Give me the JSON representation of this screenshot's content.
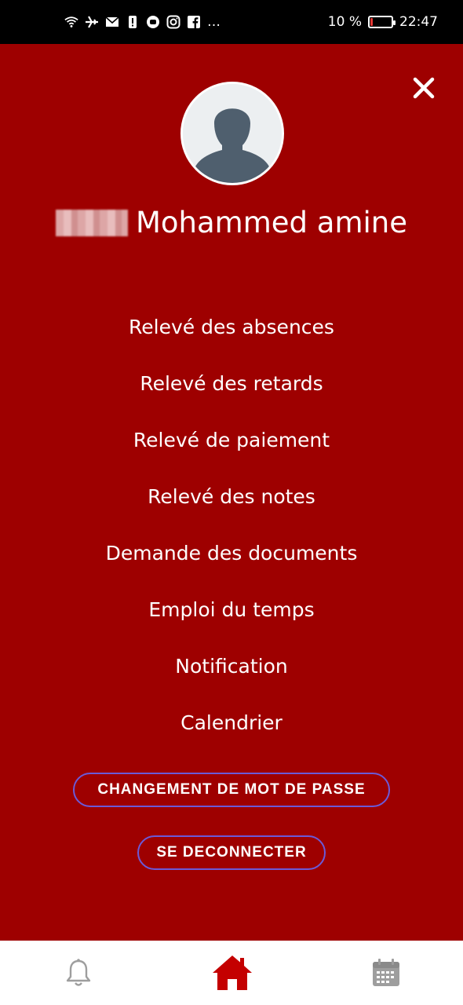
{
  "status_bar": {
    "icons": [
      "wifi-icon",
      "airplane-icon",
      "mail-icon",
      "alert-icon",
      "app-icon",
      "instagram-icon",
      "facebook-icon",
      "more-icon"
    ],
    "more": "…",
    "battery_percent": "10 %",
    "battery_level": 0.1,
    "time": "22:47"
  },
  "drawer": {
    "user_name": "Mohammed amine",
    "menu": [
      {
        "label": "Relevé des absences"
      },
      {
        "label": "Relevé des retards"
      },
      {
        "label": "Relevé de paiement"
      },
      {
        "label": "Relevé des notes"
      },
      {
        "label": "Demande des documents"
      },
      {
        "label": "Emploi du temps"
      },
      {
        "label": "Notification"
      },
      {
        "label": "Calendrier"
      }
    ],
    "change_password_label": "CHANGEMENT DE MOT DE PASSE",
    "logout_label": "SE DECONNECTER"
  },
  "bottom_nav": {
    "items": [
      "bell-icon",
      "home-icon",
      "calendar-icon"
    ],
    "active": "home-icon"
  },
  "colors": {
    "drawer_bg": "#9e0000",
    "button_border": "#6b5ad8",
    "home_active": "#c40000",
    "inactive_icon": "#9e9e9e"
  }
}
